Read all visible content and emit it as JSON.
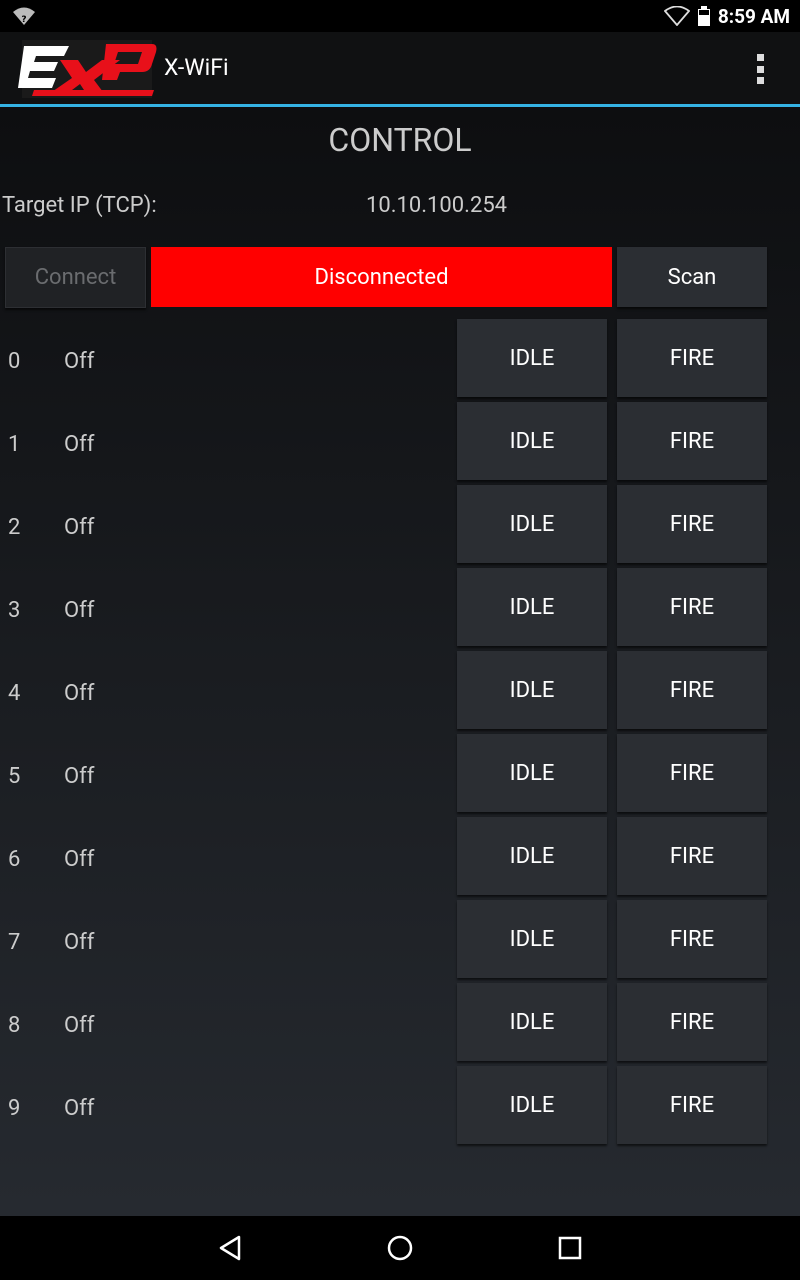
{
  "status_bar": {
    "time": "8:59 AM",
    "left_icon": "wifi-unknown-icon",
    "right_icons": [
      "wifi-icon",
      "battery-icon"
    ]
  },
  "action_bar": {
    "logo": "EXP-logo",
    "title": "X-WiFi",
    "overflow_icon": "overflow-menu-icon"
  },
  "control": {
    "title": "CONTROL",
    "target_ip_label": "Target IP (TCP):",
    "target_ip_value": "10.10.100.254",
    "connect_label": "Connect",
    "status_label": "Disconnected",
    "scan_label": "Scan",
    "status_color": "#ff0000"
  },
  "channels": [
    {
      "num": "0",
      "state": "Off",
      "idle_label": "IDLE",
      "fire_label": "FIRE"
    },
    {
      "num": "1",
      "state": "Off",
      "idle_label": "IDLE",
      "fire_label": "FIRE"
    },
    {
      "num": "2",
      "state": "Off",
      "idle_label": "IDLE",
      "fire_label": "FIRE"
    },
    {
      "num": "3",
      "state": "Off",
      "idle_label": "IDLE",
      "fire_label": "FIRE"
    },
    {
      "num": "4",
      "state": "Off",
      "idle_label": "IDLE",
      "fire_label": "FIRE"
    },
    {
      "num": "5",
      "state": "Off",
      "idle_label": "IDLE",
      "fire_label": "FIRE"
    },
    {
      "num": "6",
      "state": "Off",
      "idle_label": "IDLE",
      "fire_label": "FIRE"
    },
    {
      "num": "7",
      "state": "Off",
      "idle_label": "IDLE",
      "fire_label": "FIRE"
    },
    {
      "num": "8",
      "state": "Off",
      "idle_label": "IDLE",
      "fire_label": "FIRE"
    },
    {
      "num": "9",
      "state": "Off",
      "idle_label": "IDLE",
      "fire_label": "FIRE"
    }
  ],
  "nav_bar": {
    "icons": [
      "back-icon",
      "home-icon",
      "recents-icon"
    ]
  },
  "colors": {
    "accent": "#35b3e4",
    "button_bg": "#2b2e33",
    "status_disconnected": "#ff0000"
  }
}
